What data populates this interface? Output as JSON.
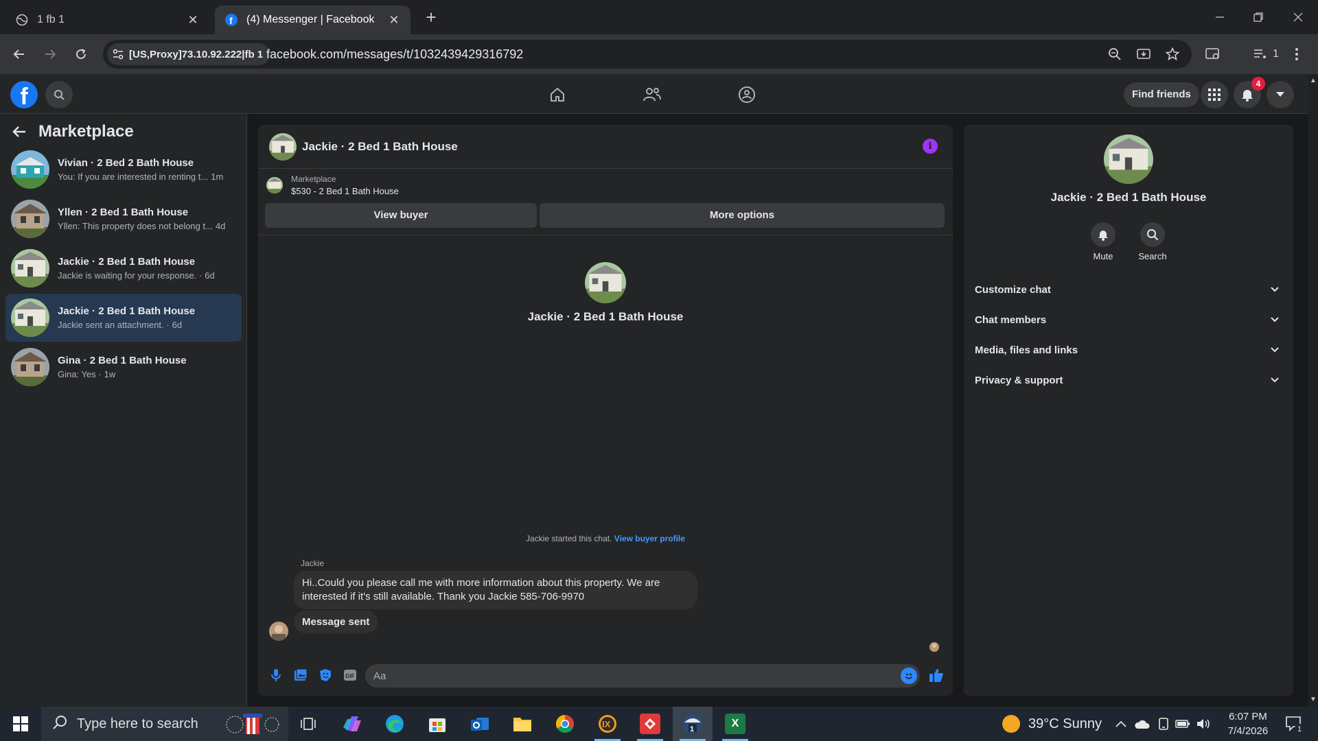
{
  "browser": {
    "tabs": [
      {
        "title": "1 fb 1",
        "icon": "globe-icon"
      },
      {
        "title": "(4) Messenger | Facebook",
        "icon": "facebook-icon"
      }
    ],
    "site_chip": "[US,Proxy]73.10.92.222|fb 1",
    "url": "facebook.com/messages/t/1032439429316792",
    "profile_count": "1"
  },
  "fb_header": {
    "logo": "f",
    "find_friends": "Find friends",
    "notifications_badge": "4"
  },
  "left_panel": {
    "title": "Marketplace",
    "conversations": [
      {
        "name": "Vivian · 2 Bed 2 Bath House",
        "preview": "You: If you are interested in renting t...",
        "time": "1m",
        "selected": false
      },
      {
        "name": "Yllen · 2 Bed 1 Bath House",
        "preview": "Yllen: This property does not belong t...",
        "time": "4d",
        "selected": false
      },
      {
        "name": "Jackie · 2 Bed 1 Bath House",
        "preview": "Jackie is waiting for your response. ·",
        "time": "6d",
        "selected": false
      },
      {
        "name": "Jackie · 2 Bed 1 Bath House",
        "preview": "Jackie sent an attachment. ·",
        "time": "6d",
        "selected": true
      },
      {
        "name": "Gina · 2 Bed 1 Bath House",
        "preview": "Gina: Yes ·",
        "time": "1w",
        "selected": false
      }
    ]
  },
  "chat": {
    "title": "Jackie · 2 Bed 1 Bath House",
    "marketplace_label": "Marketplace",
    "listing": "$530 - 2 Bed 1 Bath House",
    "view_buyer": "View buyer",
    "more_options": "More options",
    "center_name": "Jackie · 2 Bed 1 Bath House",
    "started_text": "Jackie started this chat.",
    "buyer_profile_link": "View buyer profile",
    "sender": "Jackie",
    "message1": "Hi..Could you please call me with more information about this property.  We are interested if it's still available.  Thank you Jackie 585-706-9970",
    "message2": "Message sent",
    "composer_placeholder": "Aa"
  },
  "right_panel": {
    "name": "Jackie · 2 Bed 1 Bath House",
    "mute": "Mute",
    "search": "Search",
    "sections": [
      "Customize chat",
      "Chat members",
      "Media, files and links",
      "Privacy & support"
    ]
  },
  "taskbar": {
    "search_placeholder": "Type here to search",
    "weather": "39°C  Sunny",
    "time": "6:07 PM",
    "date": "7/4/2026",
    "notifications": "1"
  },
  "colors": {
    "accent": "#2d88ff",
    "selected_conv": "#263951",
    "info": "#a033ff",
    "badge": "#e41e3f"
  }
}
